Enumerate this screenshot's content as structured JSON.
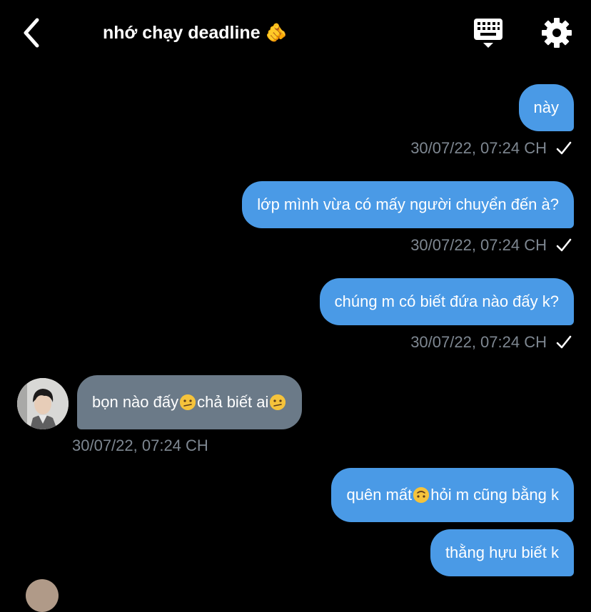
{
  "header": {
    "title": "nhớ chạy deadline 🫵"
  },
  "messages": [
    {
      "text": "này",
      "timestamp": "30/07/22, 07:24 CH"
    },
    {
      "text": "lớp mình vừa có mấy người chuyển đến à?",
      "timestamp": "30/07/22, 07:24 CH"
    },
    {
      "text": "chúng m có biết đứa nào đấy k?",
      "timestamp": "30/07/22, 07:24 CH"
    },
    {
      "text_a": "bọn nào đấy",
      "text_b": " chả biết ai",
      "timestamp": "30/07/22, 07:24 CH"
    },
    {
      "text_a": "quên mất",
      "text_b": " hỏi m cũng bằng k"
    },
    {
      "text": "thằng hựu biết k"
    }
  ],
  "icons": {
    "back": "chevron-left-icon",
    "keyboard": "keyboard-icon",
    "settings": "gear-icon",
    "read": "checkmark-icon",
    "emoji_confused": "confused-face-emoji",
    "emoji_upside": "upside-down-face-emoji"
  },
  "colors": {
    "background": "#000000",
    "outgoing_bubble": "#4a9ae6",
    "incoming_bubble": "#6b7a88",
    "timestamp": "#7e8791"
  }
}
